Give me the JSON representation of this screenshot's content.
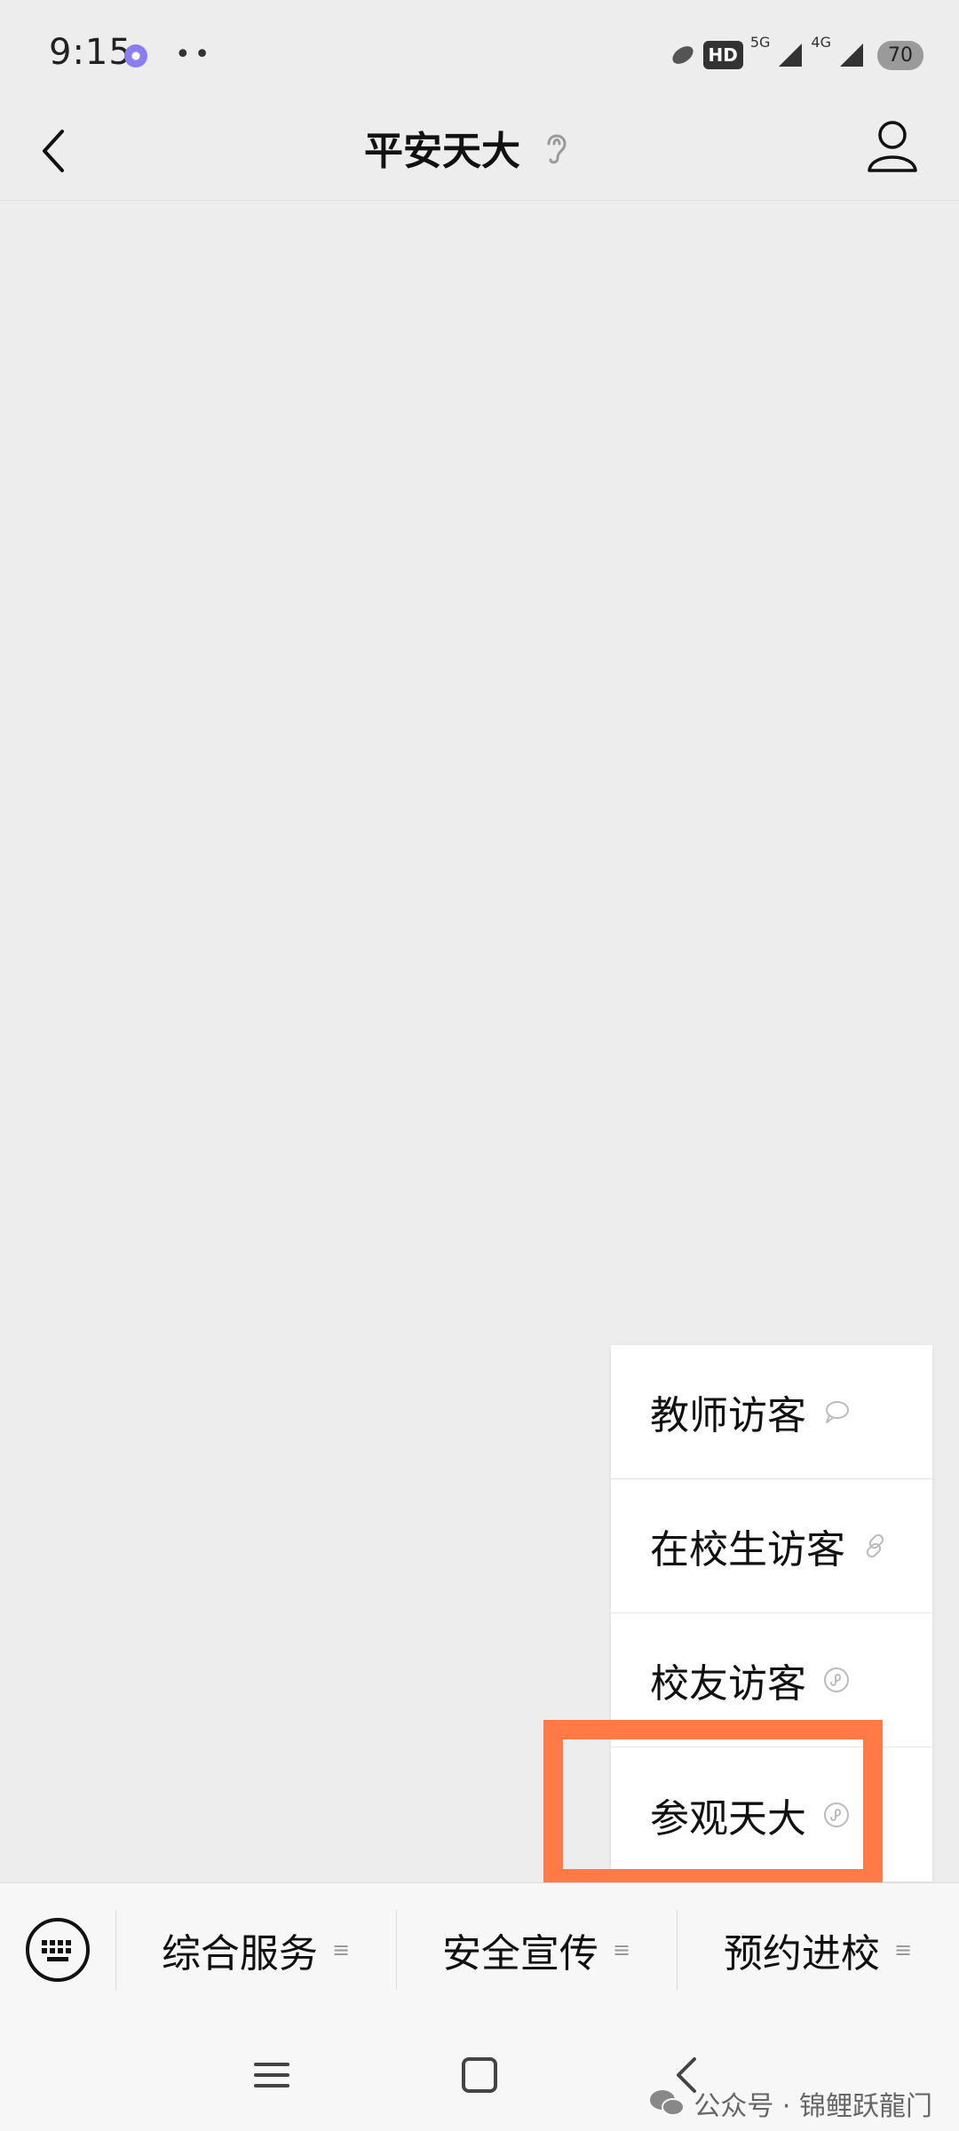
{
  "status_bar": {
    "time": "9:15",
    "dots": "••",
    "hd": "HD",
    "net1": "5G",
    "net2": "4G",
    "battery": "70"
  },
  "nav": {
    "title": "平安天大"
  },
  "popup_menu": {
    "items": [
      {
        "label": "教师访客",
        "icon": "chat-bubble-icon"
      },
      {
        "label": "在校生访客",
        "icon": "link-icon"
      },
      {
        "label": "校友访客",
        "icon": "mini-program-icon"
      },
      {
        "label": "参观天大",
        "icon": "mini-program-icon"
      }
    ]
  },
  "bottom_menu": {
    "items": [
      {
        "label": "综合服务",
        "lines": "≡"
      },
      {
        "label": "安全宣传",
        "lines": "≡"
      },
      {
        "label": "预约进校",
        "lines": "≡"
      }
    ]
  },
  "watermark": {
    "text": "公众号 · 锦鲤跃龍门"
  },
  "colors": {
    "highlight": "#ff7a46",
    "background": "#ededed"
  }
}
